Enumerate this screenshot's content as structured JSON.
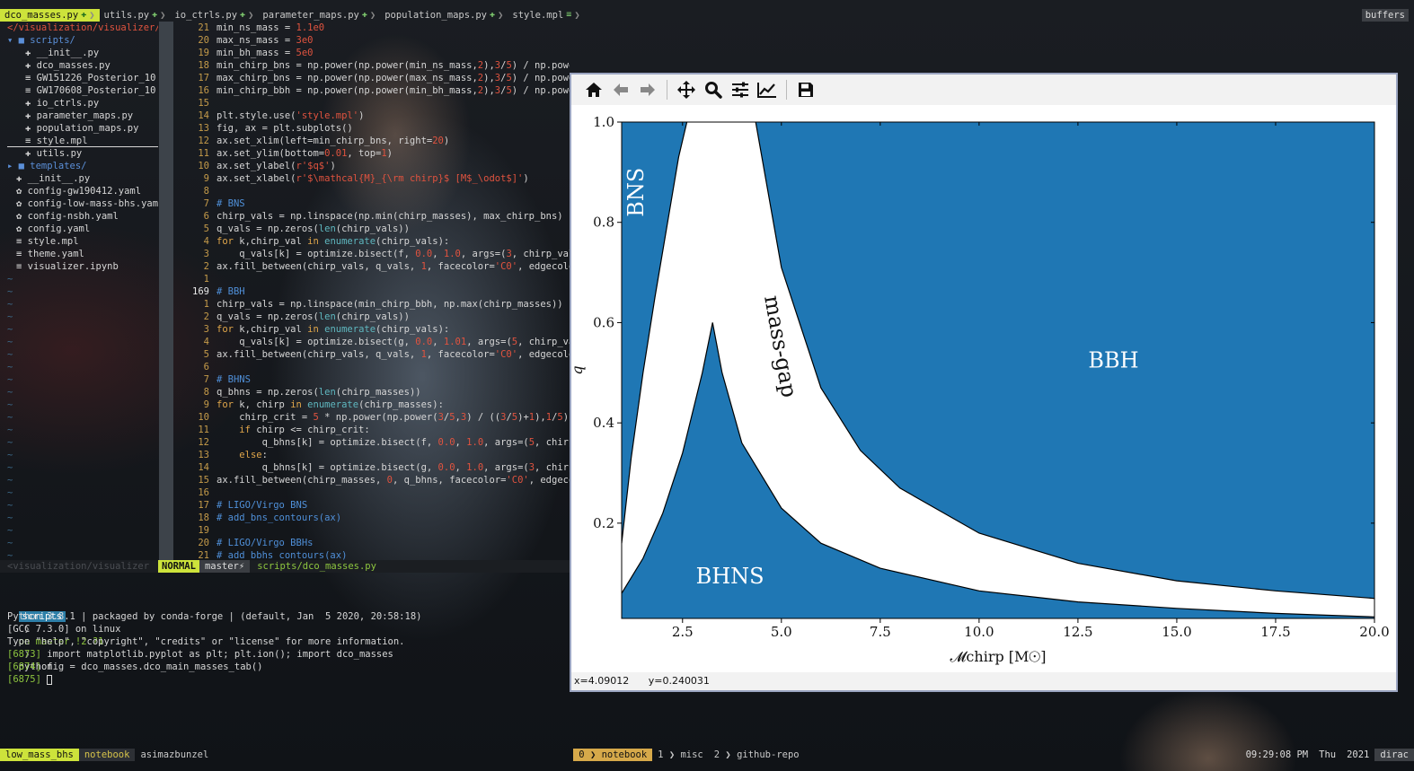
{
  "tabs": [
    {
      "label": "dco_masses.py",
      "active": true
    },
    {
      "label": "utils.py"
    },
    {
      "label": "io_ctrls.py"
    },
    {
      "label": "parameter_maps.py"
    },
    {
      "label": "population_maps.py"
    },
    {
      "label": "style.mpl"
    }
  ],
  "buffers_label": "buffers",
  "tree": [
    {
      "text": "</visualization/visualizer/",
      "color": "#e0533f",
      "indent": 0
    },
    {
      "text": "▾ ■ scripts/",
      "color": "#5b8fd8",
      "indent": 0
    },
    {
      "text": "✚ __init__.py",
      "color": "#d6d6d6",
      "indent": 2
    },
    {
      "text": "✚ dco_masses.py",
      "color": "#d6d6d6",
      "indent": 2
    },
    {
      "text": "≡ GW151226_Posterior_10",
      "color": "#d6d6d6",
      "indent": 2
    },
    {
      "text": "≡ GW170608_Posterior_10",
      "color": "#d6d6d6",
      "indent": 2
    },
    {
      "text": "✚ io_ctrls.py",
      "color": "#d6d6d6",
      "indent": 2
    },
    {
      "text": "✚ parameter_maps.py",
      "color": "#d6d6d6",
      "indent": 2
    },
    {
      "text": "✚ population_maps.py",
      "color": "#d6d6d6",
      "indent": 2
    },
    {
      "text": "≡ style.mpl",
      "color": "#d6d6d6",
      "indent": 2,
      "selected": true
    },
    {
      "text": "✚ utils.py",
      "color": "#d6d6d6",
      "indent": 2
    },
    {
      "text": "▸ ■ templates/",
      "color": "#5b8fd8",
      "indent": 0
    },
    {
      "text": "✚ __init__.py",
      "color": "#d6d6d6",
      "indent": 1
    },
    {
      "text": "✿ config-gw190412.yaml",
      "color": "#d6d6d6",
      "indent": 1
    },
    {
      "text": "✿ config-low-mass-bhs.yam",
      "color": "#d6d6d6",
      "indent": 1
    },
    {
      "text": "✿ config-nsbh.yaml",
      "color": "#d6d6d6",
      "indent": 1
    },
    {
      "text": "✿ config.yaml",
      "color": "#d6d6d6",
      "indent": 1
    },
    {
      "text": "≡ style.mpl",
      "color": "#d6d6d6",
      "indent": 1
    },
    {
      "text": "≡ theme.yaml",
      "color": "#d6d6d6",
      "indent": 1
    },
    {
      "text": "≡ visualizer.ipynb",
      "color": "#d6d6d6",
      "indent": 1
    }
  ],
  "line_numbers": [
    "21",
    "20",
    "19",
    "18",
    "17",
    "16",
    "15",
    "14",
    "13",
    "12",
    "11",
    "10",
    "9",
    "8",
    "7",
    "6",
    "5",
    "4",
    "3",
    "2",
    "1",
    "169",
    "1",
    "2",
    "3",
    "4",
    "5",
    "6",
    "7",
    "8",
    "9",
    "10",
    "11",
    "12",
    "13",
    "14",
    "15",
    "16",
    "17",
    "18",
    "19",
    "20",
    "21"
  ],
  "code_lines": [
    "min_ns_mass = <n>1.1e0</n>",
    "max_ns_mass = <n>3e0</n>",
    "min_bh_mass = <n>5e0</n>",
    "min_chirp_bns = np.power(np.power(min_ns_mass,<n>2</n>),<n>3</n>/<n>5</n>) / np.power(<n>2</n>*min_ns_mass,<n>1</n>/<n>5</n>)",
    "max_chirp_bns = np.power(np.power(max_ns_mass,<n>2</n>),<n>3</n>/<n>5</n>) / np.power(",
    "min_chirp_bbh = np.power(np.power(min_bh_mass,<n>2</n>),<n>3</n>/<n>5</n>) / np.power(",
    "",
    "plt.style.use(<s>'style.mpl'</s>)",
    "fig, ax = plt.subplots()",
    "ax.set_xlim(left=min_chirp_bns, right=<n>20</n>)",
    "ax.set_ylim(bottom=<n>0.01</n>, top=<n>1</n>)",
    "ax.set_ylabel(<s>r'$q$'</s>)",
    "ax.set_xlabel(<s>r'$\\mathcal{M}_{\\rm chirp}$ [M$_\\odot$]'</s>)",
    "",
    "<c># BNS</c>",
    "chirp_vals = np.linspace(np.min(chirp_masses), max_chirp_bns)",
    "q_vals = np.zeros(<f>len</f>(chirp_vals))",
    "<k>for</k> k,chirp_val <k>in</k> <f>enumerate</f>(chirp_vals):",
    "    q_vals[k] = optimize.bisect(f, <n>0.0</n>, <n>1.0</n>, args=(<n>3</n>, chirp_val))",
    "ax.fill_between(chirp_vals, q_vals, <n>1</n>, facecolor=<s>'C0'</s>, edgecolor=",
    "",
    "<c># BBH</c>",
    "chirp_vals = np.linspace(min_chirp_bbh, np.max(chirp_masses))",
    "q_vals = np.zeros(<f>len</f>(chirp_vals))",
    "<k>for</k> k,chirp_val <k>in</k> <f>enumerate</f>(chirp_vals):",
    "    q_vals[k] = optimize.bisect(g, <n>0.0</n>, <n>1.01</n>, args=(<n>5</n>, chirp_val))",
    "ax.fill_between(chirp_vals, q_vals, <n>1</n>, facecolor=<s>'C0'</s>, edgecolor=",
    "",
    "<c># BHNS</c>",
    "q_bhns = np.zeros(<f>len</f>(chirp_masses))",
    "<k>for</k> k, chirp <k>in</k> <f>enumerate</f>(chirp_masses):",
    "    chirp_crit = <n>5</n> * np.power(np.power(<n>3</n>/<n>5</n>,<n>3</n>) / ((<n>3</n>/<n>5</n>)+<n>1</n>),<n>1</n>/<n>5</n>)",
    "    <k>if</k> chirp <= chirp_crit:",
    "        q_bhns[k] = optimize.bisect(f, <n>0.0</n>, <n>1.0</n>, args=(<n>5</n>, chirp))",
    "    <k>else</k>:",
    "        q_bhns[k] = optimize.bisect(g, <n>0.0</n>, <n>1.0</n>, args=(<n>3</n>, chirp))",
    "ax.fill_between(chirp_masses, <n>0</n>, q_bhns, facecolor=<s>'C0'</s>, edgecolor",
    "",
    "<c># LIGO/Virgo BNS</c>",
    "<c># add_bns_contours(ax)</c>",
    "",
    "<c># LIGO/Virgo BBHs</c>",
    "<c># add_bbhs_contours(ax)</c>"
  ],
  "statusline": {
    "path": "<visualization/visualizer",
    "mode": "NORMAL",
    "branch": "master⚡",
    "file": "scripts/dco_masses.py"
  },
  "terminal": {
    "prompt_dir": "scripts",
    "prompt_branch": "on master !2 ?1",
    "prompt_cmd": "python",
    "lines": [
      "Python 3.8.1 | packaged by conda-forge | (default, Jan  5 2020, 20:58:18)",
      "[GCC 7.3.0] on linux",
      "Type \"help\", \"copyright\", \"credits\" or \"license\" for more information.",
      "[6873] import matplotlib.pyplot as plt; plt.ion(); import dco_masses",
      "[6874] fig = dco_masses.dco_main_masses_tab()",
      "[6875] "
    ]
  },
  "tmux": {
    "session": "low_mass_bhs",
    "window": "notebook",
    "host": "asimazbunzel",
    "windows": [
      {
        "idx": "0",
        "name": "notebook",
        "active": true
      },
      {
        "idx": "1",
        "name": "misc"
      },
      {
        "idx": "2",
        "name": "github-repo"
      }
    ],
    "time": "09:29:08 PM",
    "day": "Thu",
    "year": "2021",
    "user": "dirac"
  },
  "figure": {
    "toolbar_icons": [
      "home-icon",
      "back-arrow-icon",
      "forward-arrow-icon",
      "pan-icon",
      "zoom-icon",
      "subplots-config-icon",
      "edit-axes-icon",
      "save-icon"
    ],
    "coords": {
      "x": "x=4.09012",
      "y": "y=0.240031"
    }
  },
  "chart_data": {
    "type": "area",
    "xlabel": "𝓜chirp [M☉]",
    "ylabel": "q",
    "xlim": [
      0.96,
      20
    ],
    "ylim": [
      0.01,
      1.0
    ],
    "xticks": [
      2.5,
      5.0,
      7.5,
      10.0,
      12.5,
      15.0,
      17.5,
      20.0
    ],
    "xtick_labels": [
      "2.5",
      "5.0",
      "7.5",
      "10.0",
      "12.5",
      "15.0",
      "17.5",
      "20.0"
    ],
    "yticks": [
      0.2,
      0.4,
      0.6,
      0.8,
      1.0
    ],
    "ytick_labels": [
      "0.2",
      "0.4",
      "0.6",
      "0.8",
      "1.0"
    ],
    "fill_color": "#1f77b4",
    "regions": [
      {
        "label": "BNS",
        "lower_boundary": {
          "x": [
            0.96,
            1.2,
            1.5,
            1.8,
            2.1,
            2.4,
            2.61
          ],
          "q": [
            0.16,
            0.33,
            0.5,
            0.65,
            0.79,
            0.93,
            1.0
          ]
        }
      },
      {
        "label": "BBH",
        "lower_boundary": {
          "x": [
            4.35,
            5.0,
            6.0,
            7.0,
            8.0,
            10.0,
            12.5,
            15.0,
            17.5,
            20.0
          ],
          "q": [
            1.0,
            0.71,
            0.47,
            0.345,
            0.27,
            0.18,
            0.12,
            0.085,
            0.065,
            0.05
          ]
        }
      },
      {
        "label": "BHNS",
        "upper_boundary": {
          "x": [
            0.96,
            1.5,
            2.0,
            2.5,
            3.0,
            3.26,
            3.5,
            4.0,
            5.0,
            6.0,
            7.5,
            10.0,
            12.5,
            15.0,
            17.5,
            20.0
          ],
          "q": [
            0.06,
            0.13,
            0.22,
            0.34,
            0.5,
            0.6,
            0.5,
            0.36,
            0.23,
            0.16,
            0.11,
            0.065,
            0.043,
            0.03,
            0.02,
            0.013
          ]
        }
      }
    ],
    "annotations": [
      {
        "text": "BNS",
        "x": 1.5,
        "q": 0.86,
        "rotation": -90
      },
      {
        "text": "mass-gap",
        "x": 4.8,
        "q": 0.55,
        "rotation": 80
      },
      {
        "text": "BBH",
        "x": 13.4,
        "q": 0.51
      },
      {
        "text": "BHNS",
        "x": 3.7,
        "q": 0.08
      }
    ]
  }
}
